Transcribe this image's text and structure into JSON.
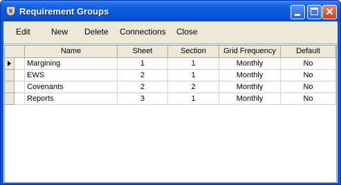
{
  "window": {
    "title": "Requirement Groups",
    "icon": "shield-icon",
    "controls": {
      "minimize": "minimize-icon",
      "maximize": "maximize-icon",
      "close": "✕"
    }
  },
  "menu": {
    "edit": "Edit",
    "new": "New",
    "delete": "Delete",
    "connections": "Connections",
    "close": "Close"
  },
  "grid": {
    "columns": [
      "Name",
      "Sheet",
      "Section",
      "Grid Frequency",
      "Default"
    ],
    "rows": [
      {
        "name": "Margining",
        "sheet": "1",
        "section": "1",
        "frequency": "Monthly",
        "default": "No",
        "current": true
      },
      {
        "name": "EWS",
        "sheet": "2",
        "section": "1",
        "frequency": "Monthly",
        "default": "No",
        "current": false
      },
      {
        "name": "Covenants",
        "sheet": "2",
        "section": "2",
        "frequency": "Monthly",
        "default": "No",
        "current": false
      },
      {
        "name": "Reports",
        "sheet": "3",
        "section": "1",
        "frequency": "Monthly",
        "default": "No",
        "current": false
      }
    ]
  },
  "colors": {
    "titlebar": "#0a58dc",
    "face": "#ece9d8",
    "close_button": "#c8431f"
  }
}
